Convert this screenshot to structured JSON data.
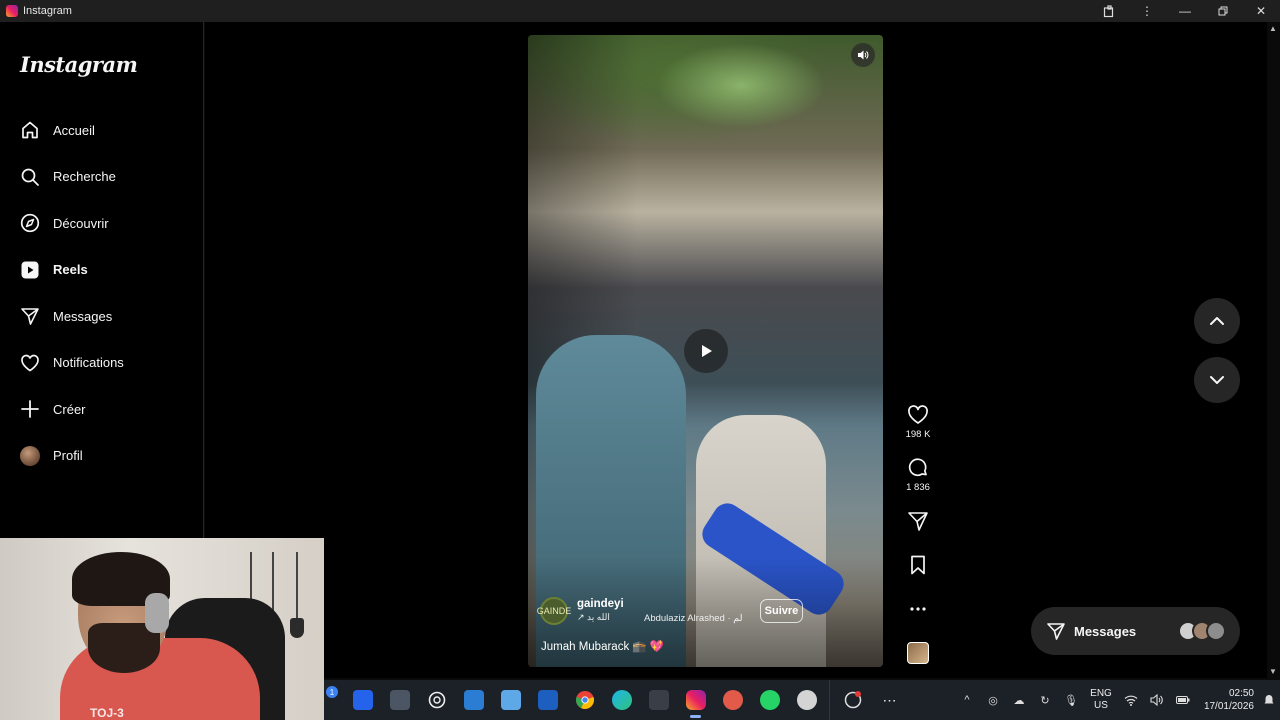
{
  "window": {
    "title": "Instagram"
  },
  "sidebar": {
    "logo": "Instagram",
    "items": [
      {
        "label": "Accueil",
        "icon": "home-icon"
      },
      {
        "label": "Recherche",
        "icon": "search-icon"
      },
      {
        "label": "Découvrir",
        "icon": "compass-icon"
      },
      {
        "label": "Reels",
        "icon": "reels-icon",
        "active": true
      },
      {
        "label": "Messages",
        "icon": "messages-icon"
      },
      {
        "label": "Notifications",
        "icon": "heart-icon"
      },
      {
        "label": "Créer",
        "icon": "plus-icon"
      },
      {
        "label": "Profil",
        "icon": "avatar"
      }
    ]
  },
  "reel": {
    "author_name": "gaindeyi",
    "author_sub": "↗ الله يد",
    "author_avatar_text": "GAINDE",
    "audio": "Abdulaziz Alrashed · لم",
    "follow_label": "Suivre",
    "caption": "Jumah Mubarack 🕋 💖",
    "likes": "198 K",
    "comments": "1 836"
  },
  "messages_pill": {
    "label": "Messages"
  },
  "webcam": {
    "shirt_text": "TOJ-3"
  },
  "taskbar": {
    "lang_line1": "ENG",
    "lang_line2": "US",
    "time": "02:50",
    "date": "17/01/2026",
    "badge_count": "1"
  },
  "colors": {
    "background": "#000000",
    "sidebar_border": "#262626",
    "arrow_button": "#262626",
    "taskbar": "#1c2128",
    "sleeve_blue": "#2a54c8"
  }
}
